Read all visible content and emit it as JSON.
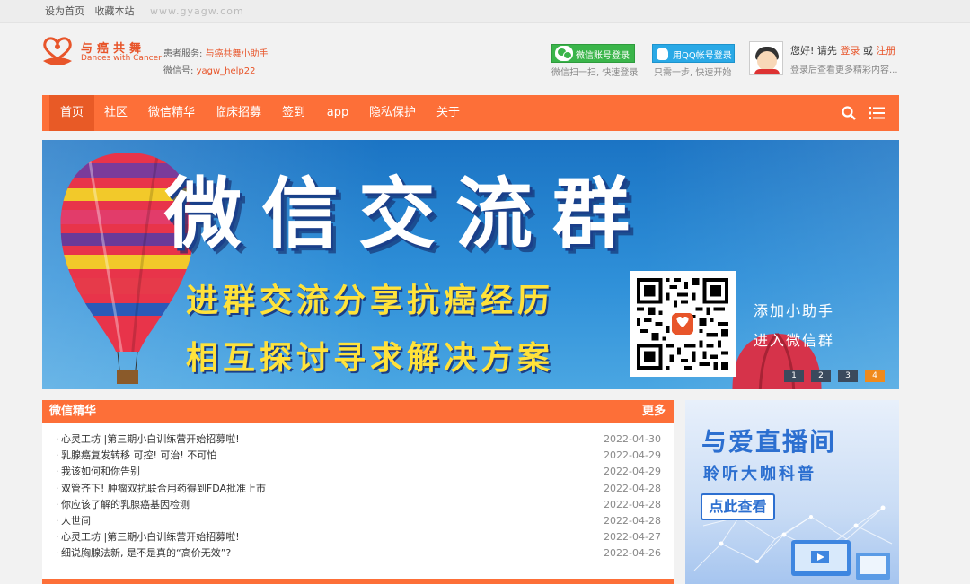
{
  "topbar": {
    "links": [
      "设为首页",
      "收藏本站"
    ],
    "watermark": "www.gyagw.com"
  },
  "brand": {
    "name_cn": "与癌共舞",
    "name_en": "Dances with Cancer"
  },
  "service": {
    "label": "患者服务:",
    "name": "与癌共舞小助手",
    "wechat_label": "微信号:",
    "wechat_id": "yagw_help22"
  },
  "login": {
    "wechat_button": "微信账号登录",
    "wechat_tip": "微信扫一扫, 快速登录",
    "qq_button": "用QQ帐号登录",
    "qq_tip": "只需一步, 快速开始",
    "greeting": "您好! 请先",
    "login_link": "登录",
    "or": "或",
    "register_link": "注册",
    "hint": "登录后查看更多精彩内容..."
  },
  "nav": {
    "items": [
      "首页",
      "社区",
      "微信精华",
      "临床招募",
      "签到",
      "app",
      "隐私保护",
      "关于"
    ],
    "active": 0
  },
  "banner": {
    "title": "微信交流群",
    "line1": "进群交流分享抗癌经历",
    "line2": "相互探讨寻求解决方案",
    "add_line1": "添加小助手",
    "add_line2": "进入微信群",
    "pages": [
      "1",
      "2",
      "3",
      "4"
    ],
    "active_page": 3
  },
  "wechat_panel": {
    "title": "微信精华",
    "more": "更多",
    "items": [
      {
        "title": "心灵工坊 |第三期小白训练营开始招募啦!",
        "date": "2022-04-30"
      },
      {
        "title": "乳腺癌复发转移 可控! 可治! 不可怕",
        "date": "2022-04-29"
      },
      {
        "title": "我该如何和你告别",
        "date": "2022-04-29"
      },
      {
        "title": "双管齐下! 肿瘤双抗联合用药得到FDA批准上市",
        "date": "2022-04-28"
      },
      {
        "title": "你应该了解的乳腺癌基因检测",
        "date": "2022-04-28"
      },
      {
        "title": "人世间",
        "date": "2022-04-28"
      },
      {
        "title": "心灵工坊 |第三期小白训练营开始招募啦!",
        "date": "2022-04-27"
      },
      {
        "title": "细说胸腺法新, 是不是真的“高价无效”?",
        "date": "2022-04-26"
      }
    ]
  },
  "side_ad": {
    "title": "与爱直播间",
    "subtitle": "聆听大咖科普",
    "button": "点此查看"
  },
  "colors": {
    "accent": "#fd6f38",
    "brand": "#e8552a",
    "wechat": "#3ab54a",
    "qq": "#2aa9e6"
  },
  "icons": [
    "logo-heart-icon",
    "wechat-icon",
    "qq-icon",
    "search-icon",
    "list-menu-icon",
    "balloon-icon"
  ]
}
